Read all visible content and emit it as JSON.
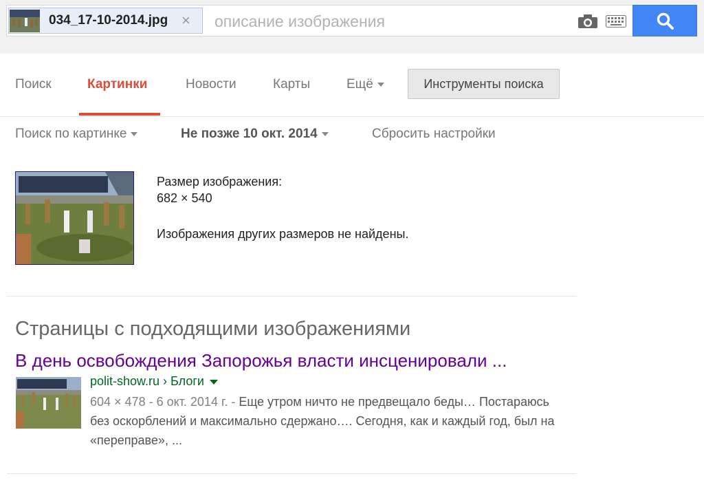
{
  "search": {
    "chip_filename": "034_17-10-2014.jpg",
    "chip_close": "×",
    "placeholder": "описание изображения",
    "query_value": ""
  },
  "icons": {
    "camera": "camera-icon",
    "keyboard": "keyboard-icon",
    "search": "search-icon",
    "close": "close-icon"
  },
  "tabs": [
    {
      "label": "Поиск",
      "active": false
    },
    {
      "label": "Картинки",
      "active": true
    },
    {
      "label": "Новости",
      "active": false
    },
    {
      "label": "Карты",
      "active": false
    },
    {
      "label": "Ещё",
      "active": false
    }
  ],
  "tools_button": "Инструменты поиска",
  "filters": {
    "search_by_image": "Поиск по картинке",
    "date": "Не позже 10 окт. 2014",
    "reset": "Сбросить настройки"
  },
  "image_info": {
    "size_label": "Размер изображения:",
    "size_value": "682 × 540",
    "no_other_sizes": "Изображения других размеров не найдены."
  },
  "pages_section": {
    "title": "Страницы с подходящими изображениями",
    "results": [
      {
        "title": "В день освобождения Запорожья власти инсценировали ...",
        "url": "polit-show.ru › Блоги",
        "meta": "604 × 478 - 6 окт. 2014 г. - ",
        "snippet": "Еще утром ничто не предвещало беды… Постараюсь без оскорблений и максимально сдержано…. Сегодня, как и каждый год, был на «переправе», ..."
      }
    ]
  },
  "colors": {
    "accent_red": "#dd4b39",
    "search_blue": "#4285f4",
    "visited_link": "#660099",
    "url_green": "#006621"
  }
}
